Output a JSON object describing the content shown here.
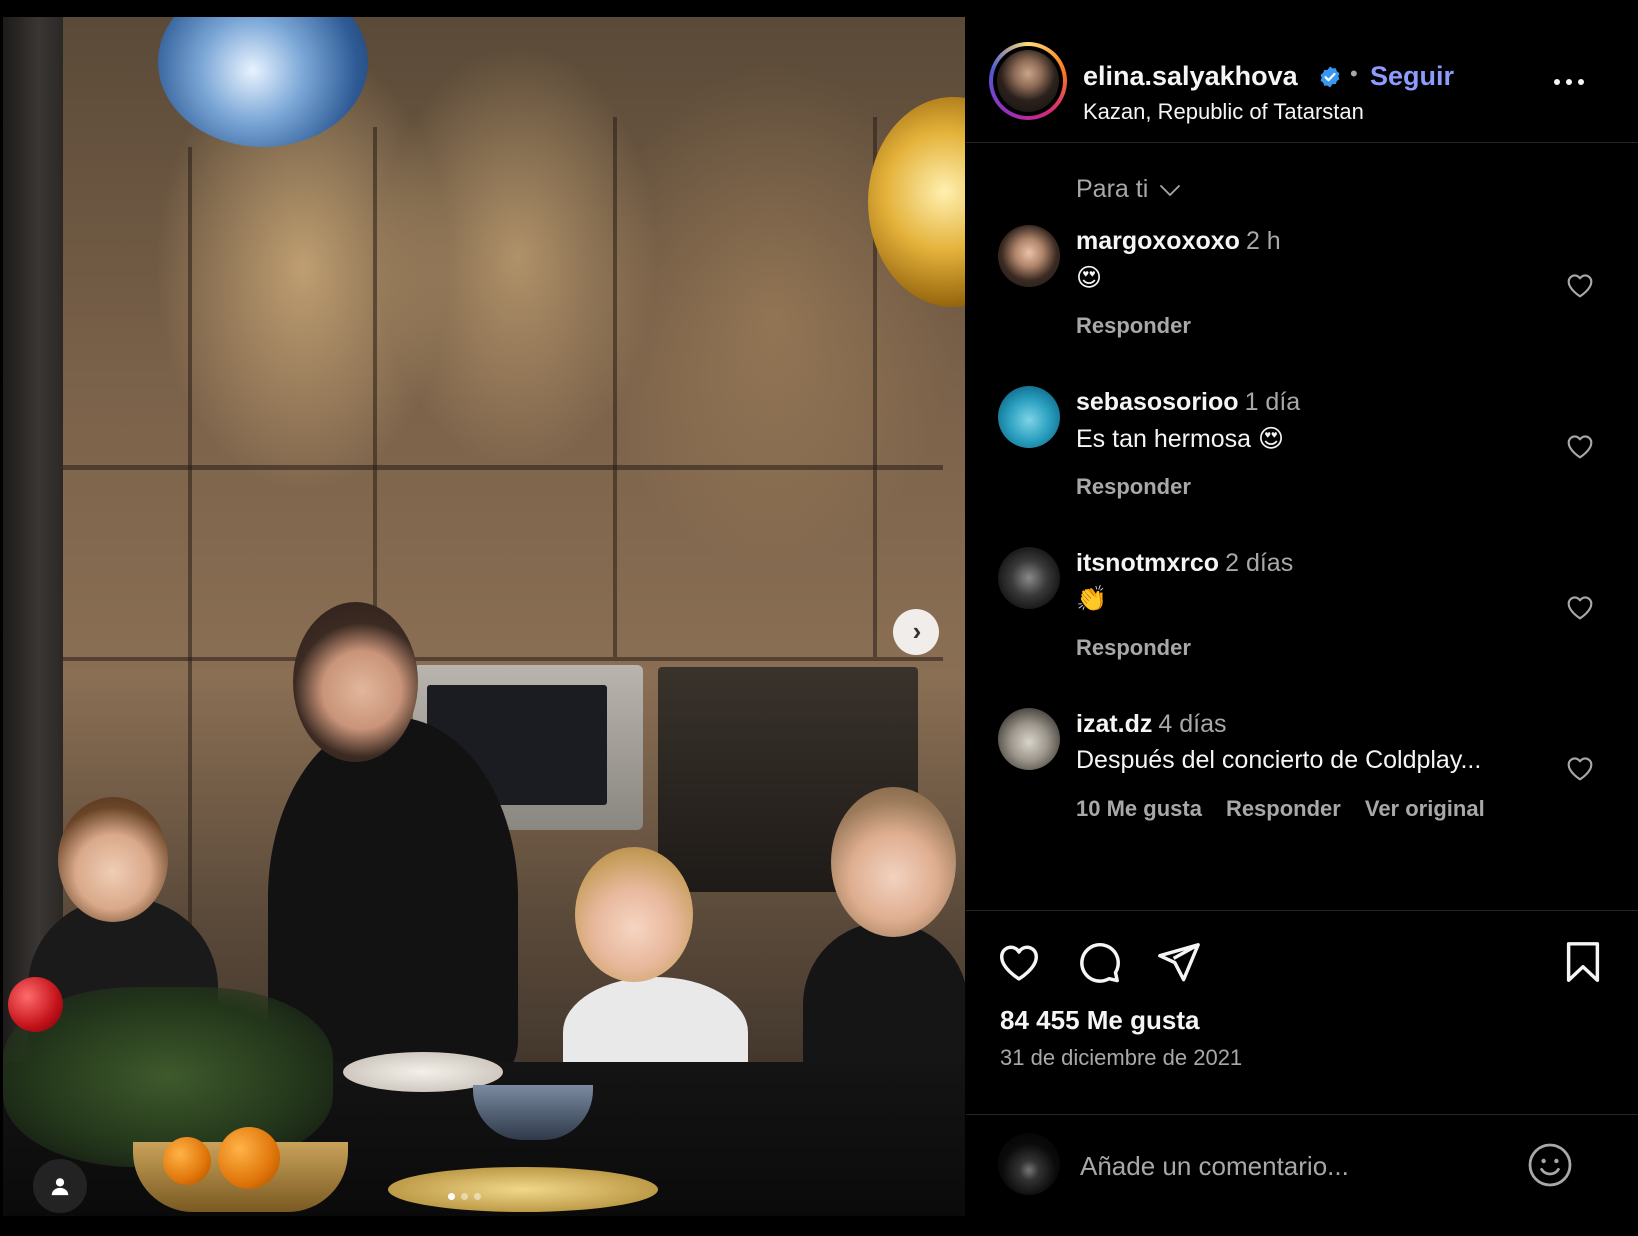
{
  "post": {
    "author": "elina.salyakhova",
    "verified": true,
    "follow_label": "Seguir",
    "separator": "•",
    "location": "Kazan, Republic of Tatarstan",
    "carousel": {
      "current": 1,
      "total": 3
    }
  },
  "comments_sort": {
    "label": "Para ti"
  },
  "comments": [
    {
      "user": "margoxoxoxo",
      "time": "2 h",
      "text": "😍",
      "actions": [
        "Responder"
      ]
    },
    {
      "user": "sebasosorioo",
      "time": "1 día",
      "text": "Es tan hermosa 😍",
      "actions": [
        "Responder"
      ]
    },
    {
      "user": "itsnotmxrco",
      "time": "2 días",
      "text": "👏",
      "actions": [
        "Responder"
      ]
    },
    {
      "user": "izat.dz",
      "time": "4 días",
      "text": "Después del concierto de Coldplay...",
      "actions": [
        "10 Me gusta",
        "Responder",
        "Ver original"
      ]
    }
  ],
  "stats": {
    "likes": "84 455 Me gusta",
    "date": "31 de diciembre de 2021"
  },
  "composer": {
    "placeholder": "Añade un comentario..."
  },
  "icons": {
    "verified": "verified-badge-icon",
    "more": "more-options-icon",
    "sort": "chevron-down-icon",
    "comment_like": "heart-outline-icon",
    "like": "heart-icon",
    "comment": "comment-bubble-icon",
    "share": "paper-plane-icon",
    "save": "bookmark-icon",
    "emoji": "smiley-icon",
    "next": "chevron-right-icon",
    "tag": "user-tag-icon"
  },
  "colors": {
    "background": "#000000",
    "text": "#f5f5f5",
    "secondary_text": "#a8a8a8",
    "follow": "#8d9bff",
    "verified": "#3897f0",
    "divider": "#262626"
  }
}
